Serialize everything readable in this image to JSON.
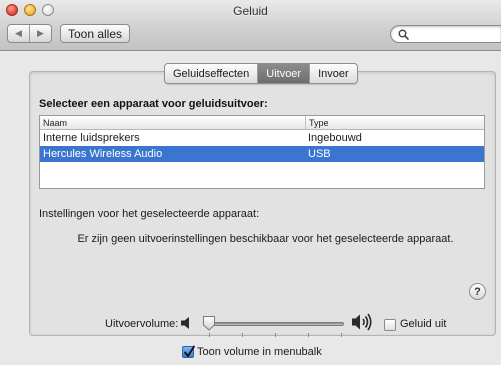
{
  "window": {
    "title": "Geluid"
  },
  "toolbar": {
    "back_icon": "◀",
    "forward_icon": "▶",
    "show_all_label": "Toon alles",
    "search_placeholder": ""
  },
  "tabs": [
    {
      "label": "Geluidseffecten",
      "active": false
    },
    {
      "label": "Uitvoer",
      "active": true
    },
    {
      "label": "Invoer",
      "active": false
    }
  ],
  "output": {
    "heading": "Selecteer een apparaat voor geluidsuitvoer:",
    "columns": {
      "name": "Naam",
      "type": "Type"
    },
    "devices": [
      {
        "name": "Interne luidsprekers",
        "type": "Ingebouwd",
        "selected": false
      },
      {
        "name": "Hercules Wireless Audio",
        "type": "USB",
        "selected": true
      }
    ],
    "settings_label": "Instellingen voor het geselecteerde apparaat:",
    "no_settings_message": "Er zijn geen uitvoerinstellingen beschikbaar voor het geselecteerde apparaat."
  },
  "help": {
    "label": "?"
  },
  "volume": {
    "label": "Uitvoervolume:",
    "level": 0.0,
    "mute_label": "Geluid uit",
    "mute_checked": false,
    "menubar_label": "Toon volume in menubalk",
    "menubar_checked": true
  },
  "colors": {
    "selection": "#3a76d0",
    "active_tab": "#7d7d7d"
  }
}
